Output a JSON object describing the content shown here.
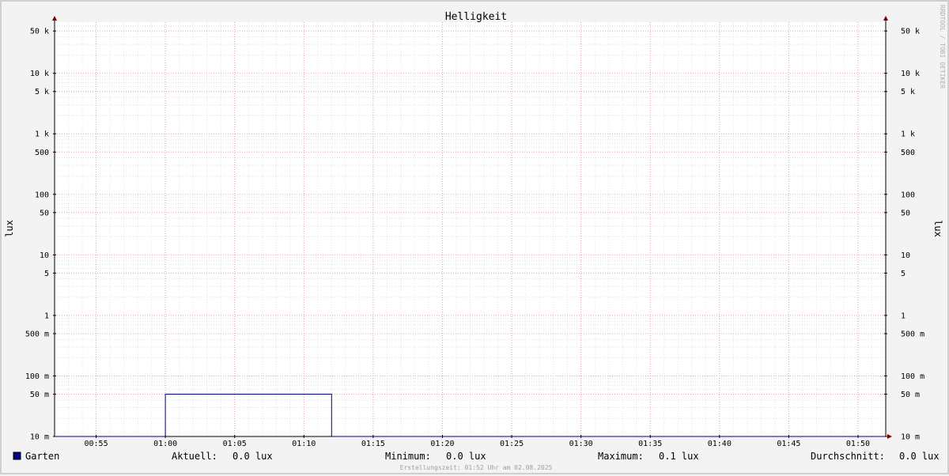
{
  "chart_data": {
    "type": "line",
    "title": "Helligkeit",
    "ylabel": "lux",
    "yscale": "log",
    "ylim": [
      0.01,
      70000
    ],
    "y_ticks": [
      {
        "value": 0.01,
        "label": "10 m"
      },
      {
        "value": 0.05,
        "label": "50 m"
      },
      {
        "value": 0.1,
        "label": "100 m"
      },
      {
        "value": 0.5,
        "label": "500 m"
      },
      {
        "value": 1,
        "label": "1"
      },
      {
        "value": 5,
        "label": "5"
      },
      {
        "value": 10,
        "label": "10"
      },
      {
        "value": 50,
        "label": "50"
      },
      {
        "value": 100,
        "label": "100"
      },
      {
        "value": 500,
        "label": "500"
      },
      {
        "value": 1000,
        "label": "1 k"
      },
      {
        "value": 5000,
        "label": "5 k"
      },
      {
        "value": 10000,
        "label": "10 k"
      },
      {
        "value": 50000,
        "label": "50 k"
      }
    ],
    "xlim": [
      "00:52",
      "01:52"
    ],
    "x_ticks": [
      "00:55",
      "01:00",
      "01:05",
      "01:10",
      "01:15",
      "01:20",
      "01:25",
      "01:30",
      "01:35",
      "01:40",
      "01:45",
      "01:50"
    ],
    "grid": true,
    "series": [
      {
        "name": "Garten",
        "color": "#000080",
        "x": [
          "00:52",
          "01:00",
          "01:00",
          "01:12",
          "01:12",
          "01:52"
        ],
        "y": [
          0.01,
          0.01,
          0.05,
          0.05,
          0.01,
          0.01
        ]
      }
    ],
    "legend": {
      "entry": "Garten",
      "stats": [
        {
          "label": "Aktuell:",
          "value": "0.0 lux"
        },
        {
          "label": "Minimum:",
          "value": "0.0 lux"
        },
        {
          "label": "Maximum:",
          "value": "0.1 lux"
        },
        {
          "label": "Durchschnitt:",
          "value": "0.0 lux"
        }
      ]
    },
    "footer": "Erstellungszeit: 01:52 Uhr am 02.08.2025",
    "watermark": "RRDTOOL / TOBI OETIKER"
  }
}
